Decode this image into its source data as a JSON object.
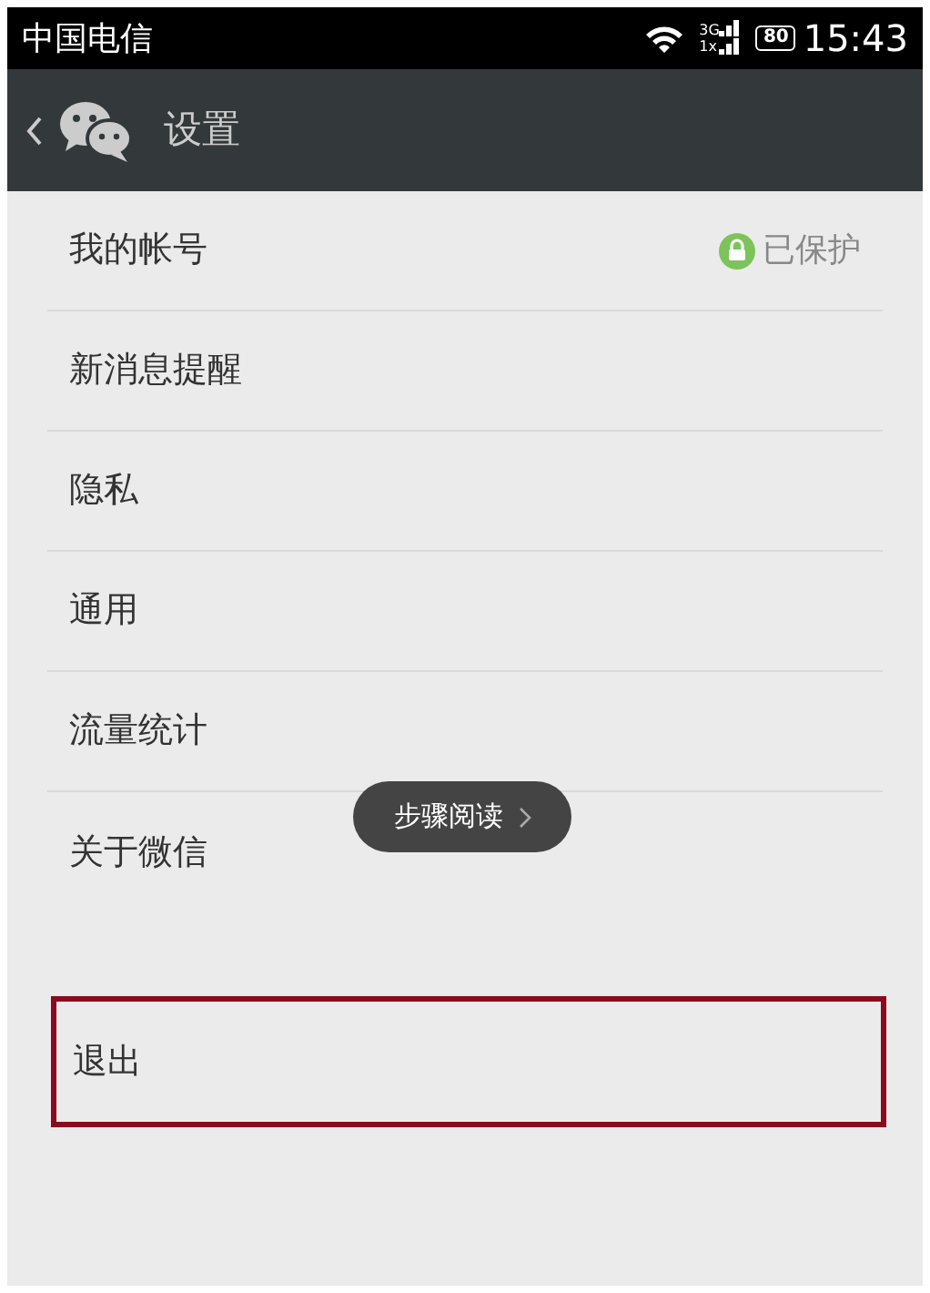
{
  "status_bar": {
    "carrier": "中国电信",
    "network_top": "3G",
    "network_bottom": "1x",
    "battery": "80",
    "time": "15:43"
  },
  "header": {
    "title": "设置"
  },
  "items": [
    {
      "label": "我的帐号",
      "status": "已保护"
    },
    {
      "label": "新消息提醒"
    },
    {
      "label": "隐私"
    },
    {
      "label": "通用"
    },
    {
      "label": "流量统计"
    },
    {
      "label": "关于微信"
    }
  ],
  "logout": {
    "label": "退出",
    "highlighted": true
  },
  "overlay_button": {
    "label": "步骤阅读"
  }
}
